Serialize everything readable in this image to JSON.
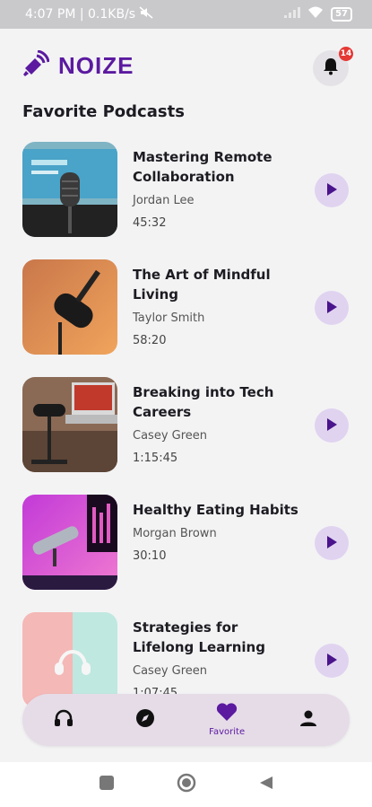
{
  "status_bar": {
    "time_speed": "4:07 PM | 0.1KB/s",
    "battery": "57"
  },
  "app": {
    "name": "NOIZE",
    "notification_count": "14",
    "brand_color": "#5b1aa0",
    "accent_light": "#e0d3f0"
  },
  "section_title": "Favorite Podcasts",
  "podcasts": [
    {
      "title": "Mastering Remote Collaboration",
      "author": "Jordan Lee",
      "duration": "45:32"
    },
    {
      "title": "The Art of Mindful Living",
      "author": "Taylor Smith",
      "duration": "58:20"
    },
    {
      "title": "Breaking into Tech Careers",
      "author": "Casey Green",
      "duration": "1:15:45"
    },
    {
      "title": "Healthy Eating Habits",
      "author": "Morgan Brown",
      "duration": "30:10"
    },
    {
      "title": "Strategies for Lifelong Learning",
      "author": "Casey Green",
      "duration": "1:07:45"
    }
  ],
  "bottom_nav": {
    "items": [
      {
        "icon": "headphones-icon",
        "label": ""
      },
      {
        "icon": "compass-icon",
        "label": ""
      },
      {
        "icon": "heart-icon",
        "label": "Favorite"
      },
      {
        "icon": "person-icon",
        "label": ""
      }
    ],
    "active_index": 2
  }
}
